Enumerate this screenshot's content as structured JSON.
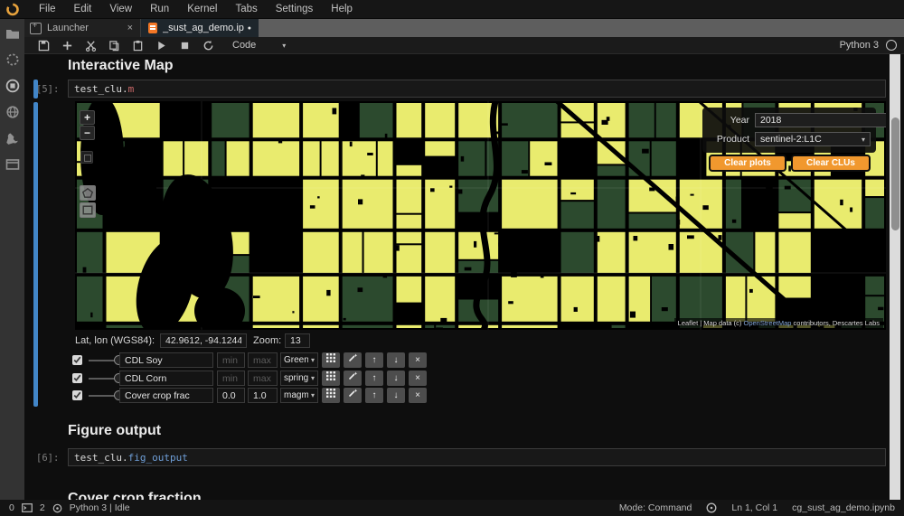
{
  "colors": {
    "accent_blue": "#4286c8",
    "button_orange": "#f1982e",
    "field_yellow": "#e9eb6e",
    "field_green": "#2c4a2e",
    "map_background": "#000000"
  },
  "icons": {
    "close": "×",
    "chevron_down": "▾",
    "dot": "●",
    "plus": "+",
    "minus": "−",
    "up_arrow": "↑",
    "down_arrow": "↓",
    "remove": "×"
  },
  "menu": {
    "items": [
      "File",
      "Edit",
      "View",
      "Run",
      "Kernel",
      "Tabs",
      "Settings",
      "Help"
    ]
  },
  "tabs": {
    "launcher": "Launcher",
    "notebook": "_sust_ag_demo.ipynb"
  },
  "toolbar": {
    "cell_type": "Code",
    "kernel_name": "Python 3"
  },
  "notebook": {
    "section1": "Interactive Map",
    "cell5_prompt": "[5]:",
    "cell5_code_obj": "test_clu.",
    "cell5_code_attr": "m",
    "section2": "Figure output",
    "cell6_prompt": "[6]:",
    "cell6_code_obj": "test_clu.",
    "cell6_code_attr": "fig_output",
    "section3": "Cover crop fraction"
  },
  "map": {
    "year_label": "Year",
    "year_value": "2018",
    "product_label": "Product",
    "product_value": "sentinel-2:L1C",
    "clear_plots_label": "Clear plots",
    "clear_clus_label": "Clear CLUs",
    "attribution_prefix": "Leaflet | Map data (c) ",
    "attribution_link": "OpenStreetMap",
    "attribution_suffix": " contributors, Descartes Labs"
  },
  "coords": {
    "latlon_label": "Lat, lon (WGS84):",
    "latlon_value": "42.9612, -94.1244",
    "zoom_label": "Zoom:",
    "zoom_value": "13"
  },
  "layers": [
    {
      "name": "CDL Soy",
      "min": "",
      "max": "",
      "min_placeholder": "min",
      "max_placeholder": "max",
      "cmap": "Green"
    },
    {
      "name": "CDL Corn",
      "min": "",
      "max": "",
      "min_placeholder": "min",
      "max_placeholder": "max",
      "cmap": "spring"
    },
    {
      "name": "Cover crop frac",
      "min": "0.0",
      "max": "1.0",
      "min_placeholder": "min",
      "max_placeholder": "max",
      "cmap": "magma"
    }
  ],
  "statusbar": {
    "terminals": "0",
    "kernels": "2",
    "kernel_status": "Python 3 | Idle",
    "mode": "Mode: Command",
    "cursor": "Ln 1, Col 1",
    "filename": "cg_sust_ag_demo.ipynb"
  }
}
